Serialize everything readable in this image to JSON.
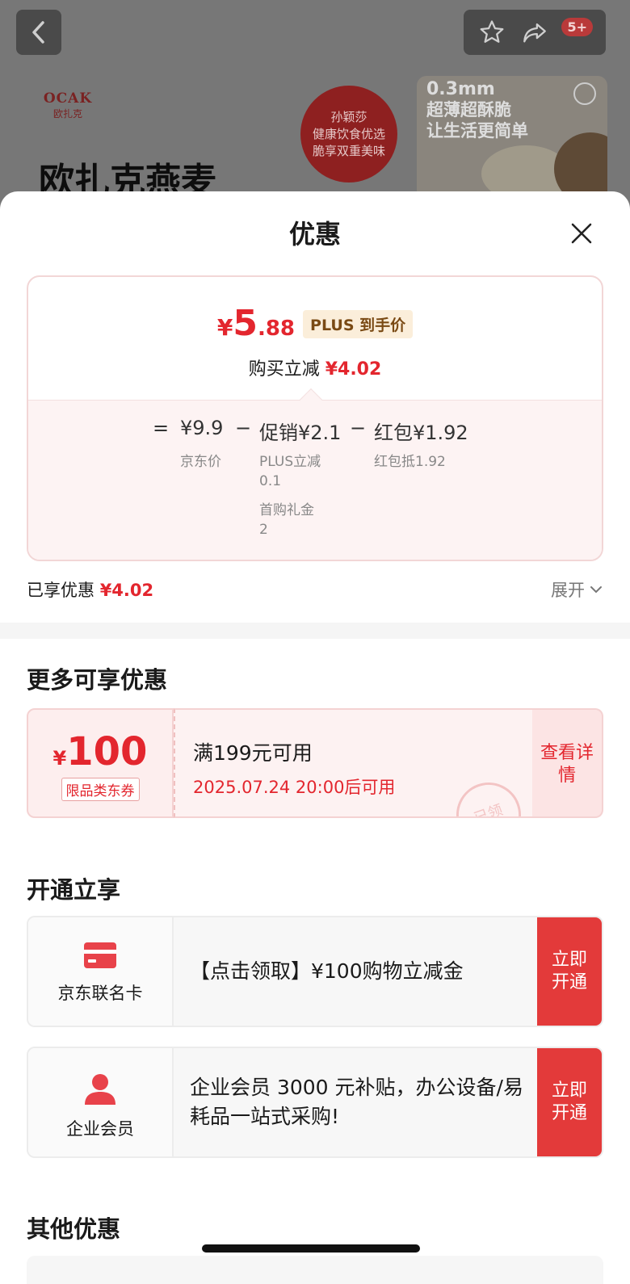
{
  "header": {
    "badge": "5+",
    "brand_logo_top": "OCAK",
    "brand_logo_sub": "欧扎克",
    "brand_title": "欧扎克燕麦",
    "promo_circle": [
      "孙颖莎",
      "健康饮食优选",
      "脆享双重美味"
    ],
    "promo_image_line1": "0.3mm",
    "promo_image_line2": "超薄超酥脆",
    "promo_image_line3": "让生活更简单"
  },
  "sheet": {
    "title": "优惠",
    "price": {
      "yen": "¥",
      "int": "5",
      "dec": ".88",
      "tag": "PLUS 到手价",
      "reduce_label": "购买立减",
      "reduce_value": "¥4.02"
    },
    "formula": {
      "eq": "=",
      "jd_price": "¥9.9",
      "minus1": "−",
      "promo": "促销¥2.1",
      "minus2": "−",
      "redpacket": "红包¥1.92",
      "jd_price_label": "京东价",
      "promo_sub1": "PLUS立减",
      "promo_sub1_val": "0.1",
      "promo_sub2": "首购礼金",
      "promo_sub2_val": "2",
      "redpacket_sub": "红包抵1.92"
    },
    "enjoyed_label": "已享优惠",
    "enjoyed_value": "¥4.02",
    "expand_label": "展开"
  },
  "more": {
    "heading": "更多可享优惠",
    "coupon": {
      "yen": "¥",
      "amount": "100",
      "tag": "限品类东券",
      "condition": "满199元可用",
      "date": "2025.07.24 20:00后可用",
      "stamp": "已领",
      "action": "查看详情"
    }
  },
  "open": {
    "heading": "开通立享",
    "items": [
      {
        "label": "京东联名卡",
        "text": "【点击领取】¥100购物立减金",
        "action": "立即开通"
      },
      {
        "label": "企业会员",
        "text": "企业会员 3000 元补贴，办公设备/易耗品一站式采购!",
        "action": "立即开通"
      }
    ]
  },
  "other": {
    "heading": "其他优惠"
  },
  "colors": {
    "accent": "#e3262e",
    "button": "#e33a3a",
    "plus_tag_bg": "#fbeeda"
  }
}
